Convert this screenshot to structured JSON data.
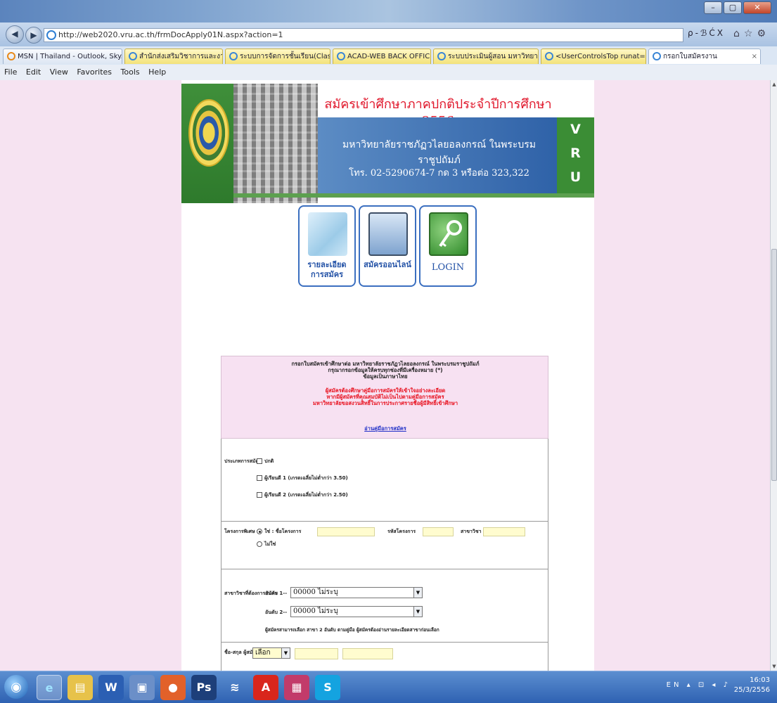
{
  "browser": {
    "url": "http://web2020.vru.ac.th/frmDocApply01N.aspx?action=1",
    "url_tools": "ρ-ℬĆX",
    "window_controls": [
      "–",
      "▢",
      "✕"
    ],
    "menu": [
      "File",
      "Edit",
      "View",
      "Favorites",
      "Tools",
      "Help"
    ],
    "tabs": [
      {
        "label": "MSN | Thailand - Outlook, Sky..."
      },
      {
        "label": "สำนักส่งเสริมวิชาการและงานทะเบี..."
      },
      {
        "label": "ระบบการจัดการชั้นเรียน(Class Ro..."
      },
      {
        "label": "ACAD-WEB BACK OFFICE"
      },
      {
        "label": "ระบบประเมินผู้สอน มหาวิทยาลัยรา..."
      },
      {
        "label": "<UserControlsTop runat=\"ser..."
      },
      {
        "label": "กรอกใบสมัครงาน"
      }
    ]
  },
  "banner": {
    "title": "สมัครเข้าศึกษาภาคปกติประจำปีการศึกษา 2556",
    "university": "มหาวิทยาลัยราชภัฏวไลยอลงกรณ์ ในพระบรมราชูปถัมภ์",
    "phone": "โทร. 02-5290674-7 กด 3 หรือต่อ 323,322",
    "vru": [
      "V",
      "R",
      "U"
    ]
  },
  "nav": [
    {
      "label_line1": "รายละเอียด",
      "label_line2": "การสมัคร"
    },
    {
      "label_line1": "สมัครออนไลน์",
      "label_line2": ""
    },
    {
      "label_line1": "LOGIN",
      "label_line2": ""
    }
  ],
  "notice": {
    "lines_black": [
      "กรอกใบสมัครเข้าศึกษาต่อ มหาวิทยาลัยราชภัฏวไลยอลงกรณ์ ในพระบรมราชูปถัมภ์",
      "กรุณากรอกข้อมูลให้ครบทุกช่องที่มีเครื่องหมาย (*)",
      "ข้อมูลเป็นภาษาไทย"
    ],
    "lines_red": [
      "ผู้สมัครต้องศึกษาคู่มือการสมัครให้เข้าใจอย่างละเอียด",
      "หากมีผู้สมัครที่คุณสมบัติไม่เป็นไปตามคู่มือการสมัคร",
      "มหาวิทยาลัยขอสงวนสิทธิ์ในการประกาศรายชื่อผู้มีสิทธิ์เข้าศึกษา"
    ],
    "link": "อ่านคู่มือการสมัคร"
  },
  "form": {
    "type_label": "ประเภทการสมัคร",
    "type_options": [
      "ปกติ",
      "ผู้เรียนดี 1 (เกรดเฉลี่ยไม่ต่ำกว่า 3.50)",
      "ผู้เรียนดี 2 (เกรดเฉลี่ยไม่ต่ำกว่า 2.50)"
    ],
    "quota_label": "โครงการพิเศษ",
    "quota_yes": "ใช่ : ชื่อโครงการ",
    "quota_field2": "รหัสโครงการ",
    "quota_field3": "สาขาวิชา",
    "quota_no": "ไม่ใช่",
    "major_label": "สาขาวิชาที่ต้องการสมัคร",
    "choice1_label": "อันดับ 1--",
    "choice1_value": "00000 ไม่ระบุ",
    "choice2_label": "อันดับ 2--",
    "choice2_value": "00000 ไม่ระบุ",
    "major_note": "ผู้สมัครสามารถเลือก สาขา 2 อันดับ ตามคู่มือ ผู้สมัครต้องอ่านรายละเอียดสาขาก่อนเลือก",
    "name_label": "ชื่อ-สกุล ผู้สมัคร",
    "prefix_value": "เลือก"
  },
  "taskbar": {
    "apps": [
      "start",
      "ie",
      "explorer",
      "word",
      "notes",
      "office",
      "ps",
      "zip",
      "pdf",
      "access",
      "skype"
    ],
    "time": "16:03",
    "date": "25/3/2556"
  }
}
